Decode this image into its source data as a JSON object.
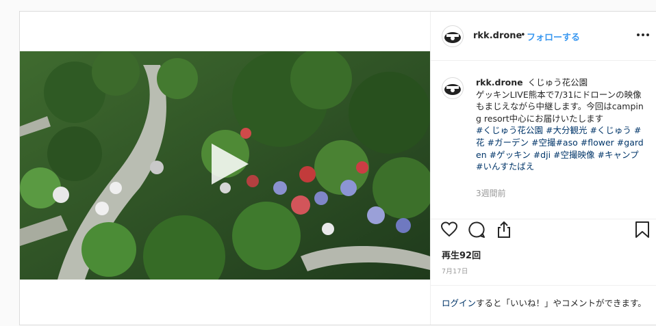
{
  "post": {
    "username": "rkk.drone",
    "separator": "•",
    "follow_label": "フォローする",
    "more_icon": "more-options-icon"
  },
  "video": {
    "play_icon": "play-icon"
  },
  "caption": {
    "username": "rkk.drone",
    "location": "くじゅう花公園",
    "body": "ゲッキンLIVE熊本で7/31にドローンの映像もまじえながら中継します。今回はcamping resort中心にお届けいたします",
    "hashtags": [
      "#くじゅう花公園",
      "#大分観光",
      "#くじゅう",
      "#花",
      "#ガーデン",
      "#空撮",
      "#aso",
      "#flower",
      "#garden",
      "#ゲッキン",
      "#dji",
      "#空撮映像",
      "#キャンプ",
      "#いんすたばえ"
    ],
    "time_ago": "3週間前"
  },
  "actions": {
    "like_icon": "heart-icon",
    "comment_icon": "comment-icon",
    "share_icon": "share-icon",
    "save_icon": "bookmark-icon"
  },
  "stats": {
    "views": "再生92回",
    "date": "7月17日"
  },
  "login": {
    "link": "ログイン",
    "rest": "すると「いいね！」やコメントができます。"
  },
  "colors": {
    "link_blue": "#3897f0",
    "hashtag": "#003569",
    "muted": "#999999",
    "border": "#dbdbdb"
  }
}
